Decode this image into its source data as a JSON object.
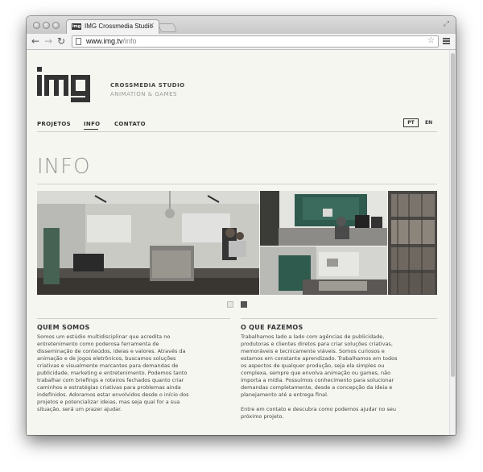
{
  "browser": {
    "tab_title": "IMG Crossmedia Studio",
    "tab_favicon_text": "img",
    "url_host": "www.img.tv",
    "url_path": "/info",
    "icons": {
      "back": "arrow-left-icon",
      "forward": "arrow-right-icon",
      "reload": "reload-icon",
      "bookmark": "star-icon",
      "menu": "hamburger-menu-icon",
      "close_tab": "close-icon",
      "fullscreen": "fullscreen-icon"
    }
  },
  "site": {
    "logo_text": "img",
    "studio_name": "CROSSMEDIA STUDIO",
    "studio_subtitle": "ANIMATION & GAMES",
    "nav": [
      {
        "label": "PROJETOS",
        "active": false
      },
      {
        "label": "INFO",
        "active": true
      },
      {
        "label": "CONTATO",
        "active": false
      }
    ],
    "languages": [
      {
        "label": "PT",
        "active": true
      },
      {
        "label": "EN",
        "active": false
      }
    ],
    "page_title": "INFO",
    "gallery": {
      "slide_count": 2,
      "active_slide": 2
    },
    "sections": [
      {
        "title": "QUEM SOMOS",
        "lines": [
          "Somos um estúdio multidisciplinar que acredita no",
          "entretenimento como poderosa ferramenta de",
          "disseminação de conteúdos, ideias e valores. Através da",
          "animação e de jogos eletrônicos, buscamos soluções",
          "criativas e visualmente marcantes para demandas de",
          "publicidade, marketing e entretenimento. Podemos tanto",
          "trabalhar com briefings e roteiros fechados quanto criar",
          "caminhos e estratégias criativas para problemas ainda",
          "indefinidos. Adoramos estar envolvidos desde o início dos",
          "projetos e potencializar ideias, mas seja qual for a sua",
          "situação, será um prazer ajudar."
        ]
      },
      {
        "title": "O QUE FAZEMOS",
        "lines": [
          "Trabalhamos lado a lado com agências de publicidade,",
          "produtoras e clientes diretos para criar soluções criativas,",
          "memoráveis e tecnicamente viáveis. Somos curiosos e",
          "estamos em constante aprendizado. Trabalhamos em todos",
          "os aspectos de qualquer produção, seja ela simples ou",
          "complexa, sempre que envolva animação ou games, não",
          "importa a mídia. Possuímos conhecimento para solucionar",
          "demandas completamente, desde a concepção da ideia e",
          "planejamento até a entrega final.",
          "",
          "Entre em contato e descubra como podemos ajudar no seu",
          "próximo projeto."
        ]
      }
    ]
  }
}
